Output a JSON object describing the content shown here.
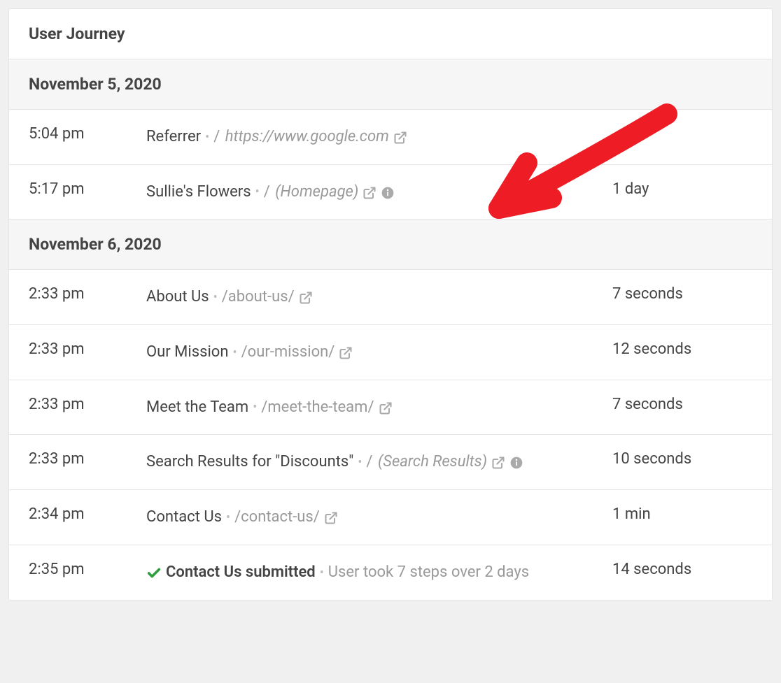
{
  "panel": {
    "title": "User Journey"
  },
  "groups": [
    {
      "date": "November 5, 2020",
      "rows": [
        {
          "time": "5:04 pm",
          "title": "Referrer",
          "titleBold": false,
          "path": "https://www.google.com",
          "pathItalic": true,
          "slashBefore": true,
          "hasExternal": true,
          "hasInfo": false,
          "duration": ""
        },
        {
          "time": "5:17 pm",
          "title": "Sullie's Flowers",
          "titleBold": false,
          "path": "(Homepage)",
          "pathItalic": true,
          "slashBefore": true,
          "hasExternal": true,
          "hasInfo": true,
          "duration": "1 day"
        }
      ]
    },
    {
      "date": "November 6, 2020",
      "rows": [
        {
          "time": "2:33 pm",
          "title": "About Us",
          "titleBold": false,
          "path": "/about-us/",
          "pathItalic": false,
          "slashBefore": false,
          "hasExternal": true,
          "hasInfo": false,
          "duration": "7 seconds"
        },
        {
          "time": "2:33 pm",
          "title": "Our Mission",
          "titleBold": false,
          "path": "/our-mission/",
          "pathItalic": false,
          "slashBefore": false,
          "hasExternal": true,
          "hasInfo": false,
          "duration": "12 seconds"
        },
        {
          "time": "2:33 pm",
          "title": "Meet the Team",
          "titleBold": false,
          "path": "/meet-the-team/",
          "pathItalic": false,
          "slashBefore": false,
          "hasExternal": true,
          "hasInfo": false,
          "duration": "7 seconds"
        },
        {
          "time": "2:33 pm",
          "title": "Search Results for \"Discounts\"",
          "titleBold": false,
          "path": "(Search Results)",
          "pathItalic": true,
          "slashBefore": true,
          "hasExternal": true,
          "hasInfo": true,
          "duration": "10 seconds"
        },
        {
          "time": "2:34 pm",
          "title": "Contact Us",
          "titleBold": false,
          "path": "/contact-us/",
          "pathItalic": false,
          "slashBefore": false,
          "hasExternal": true,
          "hasInfo": false,
          "duration": "1 min"
        },
        {
          "time": "2:35 pm",
          "title": "Contact Us submitted",
          "titleBold": true,
          "hasCheck": true,
          "summary": "User took 7 steps over 2 days",
          "duration": "14 seconds"
        }
      ]
    }
  ]
}
